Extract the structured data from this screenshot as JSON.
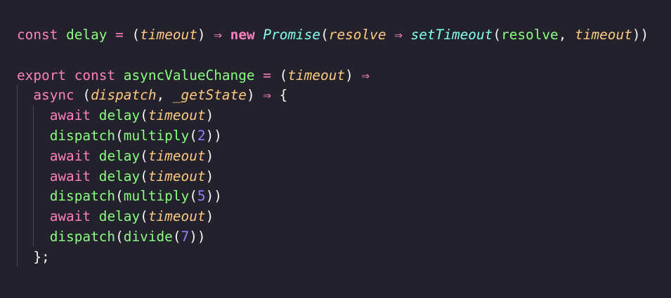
{
  "code": {
    "lines": [
      [
        {
          "t": "const",
          "c": "kw"
        },
        {
          "t": " ",
          "c": "plain"
        },
        {
          "t": "delay",
          "c": "fn"
        },
        {
          "t": " ",
          "c": "plain"
        },
        {
          "t": "=",
          "c": "op"
        },
        {
          "t": " (",
          "c": "plain"
        },
        {
          "t": "timeout",
          "c": "param"
        },
        {
          "t": ") ",
          "c": "plain"
        },
        {
          "t": "⇒",
          "c": "op"
        },
        {
          "t": " ",
          "c": "plain"
        },
        {
          "t": "new",
          "c": "new"
        },
        {
          "t": " ",
          "c": "plain"
        },
        {
          "t": "Promise",
          "c": "cls"
        },
        {
          "t": "(",
          "c": "plain"
        },
        {
          "t": "resolve",
          "c": "param"
        },
        {
          "t": " ",
          "c": "plain"
        },
        {
          "t": "⇒",
          "c": "op"
        },
        {
          "t": " ",
          "c": "plain"
        },
        {
          "t": "setTimeout",
          "c": "cls"
        },
        {
          "t": "(",
          "c": "plain"
        },
        {
          "t": "resolve",
          "c": "fn"
        },
        {
          "t": ", ",
          "c": "plain"
        },
        {
          "t": "timeout",
          "c": "param"
        },
        {
          "t": "))",
          "c": "plain"
        }
      ],
      [],
      [
        {
          "t": "export",
          "c": "kw"
        },
        {
          "t": " ",
          "c": "plain"
        },
        {
          "t": "const",
          "c": "kw"
        },
        {
          "t": " ",
          "c": "plain"
        },
        {
          "t": "asyncValueChange",
          "c": "fn"
        },
        {
          "t": " ",
          "c": "plain"
        },
        {
          "t": "=",
          "c": "op"
        },
        {
          "t": " (",
          "c": "plain"
        },
        {
          "t": "timeout",
          "c": "param"
        },
        {
          "t": ") ",
          "c": "plain"
        },
        {
          "t": "⇒",
          "c": "op"
        }
      ],
      [
        {
          "t": "  ",
          "c": "plain"
        },
        {
          "t": "async",
          "c": "kw"
        },
        {
          "t": " (",
          "c": "plain"
        },
        {
          "t": "dispatch",
          "c": "param"
        },
        {
          "t": ", ",
          "c": "plain"
        },
        {
          "t": "_getState",
          "c": "param"
        },
        {
          "t": ") ",
          "c": "plain"
        },
        {
          "t": "⇒",
          "c": "op"
        },
        {
          "t": " {",
          "c": "plain"
        }
      ],
      [
        {
          "t": "    ",
          "c": "plain"
        },
        {
          "t": "await",
          "c": "kw"
        },
        {
          "t": " ",
          "c": "plain"
        },
        {
          "t": "delay",
          "c": "fn"
        },
        {
          "t": "(",
          "c": "plain"
        },
        {
          "t": "timeout",
          "c": "param"
        },
        {
          "t": ")",
          "c": "plain"
        }
      ],
      [
        {
          "t": "    ",
          "c": "plain"
        },
        {
          "t": "dispatch",
          "c": "fn"
        },
        {
          "t": "(",
          "c": "plain"
        },
        {
          "t": "multiply",
          "c": "fn"
        },
        {
          "t": "(",
          "c": "plain"
        },
        {
          "t": "2",
          "c": "num"
        },
        {
          "t": "))",
          "c": "plain"
        }
      ],
      [
        {
          "t": "    ",
          "c": "plain"
        },
        {
          "t": "await",
          "c": "kw"
        },
        {
          "t": " ",
          "c": "plain"
        },
        {
          "t": "delay",
          "c": "fn"
        },
        {
          "t": "(",
          "c": "plain"
        },
        {
          "t": "timeout",
          "c": "param"
        },
        {
          "t": ")",
          "c": "plain"
        }
      ],
      [
        {
          "t": "    ",
          "c": "plain"
        },
        {
          "t": "await",
          "c": "kw"
        },
        {
          "t": " ",
          "c": "plain"
        },
        {
          "t": "delay",
          "c": "fn"
        },
        {
          "t": "(",
          "c": "plain"
        },
        {
          "t": "timeout",
          "c": "param"
        },
        {
          "t": ")",
          "c": "plain"
        }
      ],
      [
        {
          "t": "    ",
          "c": "plain"
        },
        {
          "t": "dispatch",
          "c": "fn"
        },
        {
          "t": "(",
          "c": "plain"
        },
        {
          "t": "multiply",
          "c": "fn"
        },
        {
          "t": "(",
          "c": "plain"
        },
        {
          "t": "5",
          "c": "num"
        },
        {
          "t": "))",
          "c": "plain"
        }
      ],
      [
        {
          "t": "    ",
          "c": "plain"
        },
        {
          "t": "await",
          "c": "kw"
        },
        {
          "t": " ",
          "c": "plain"
        },
        {
          "t": "delay",
          "c": "fn"
        },
        {
          "t": "(",
          "c": "plain"
        },
        {
          "t": "timeout",
          "c": "param"
        },
        {
          "t": ")",
          "c": "plain"
        }
      ],
      [
        {
          "t": "    ",
          "c": "plain"
        },
        {
          "t": "dispatch",
          "c": "fn"
        },
        {
          "t": "(",
          "c": "plain"
        },
        {
          "t": "divide",
          "c": "fn"
        },
        {
          "t": "(",
          "c": "plain"
        },
        {
          "t": "7",
          "c": "num"
        },
        {
          "t": "))",
          "c": "plain"
        }
      ],
      [
        {
          "t": "  ",
          "c": "plain"
        },
        {
          "t": "};",
          "c": "plain"
        }
      ]
    ]
  },
  "colors": {
    "background": "#22212c",
    "keyword": "#ff80bf",
    "function": "#8aff80",
    "parameter": "#ffca80",
    "class": "#80ffea",
    "number": "#9580ff",
    "text": "#f8f8f2"
  }
}
